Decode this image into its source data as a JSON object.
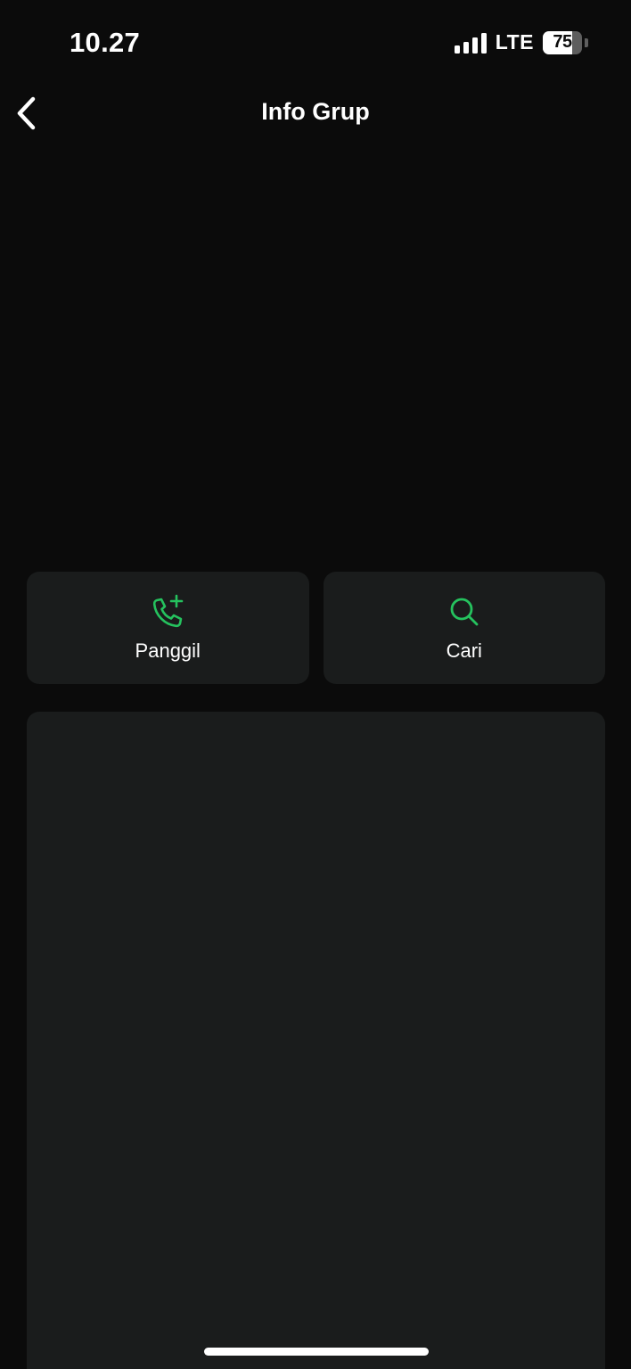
{
  "status_bar": {
    "time": "10.27",
    "network": "LTE",
    "battery": "75",
    "battery_level_percent": 75,
    "signal_bars": 4
  },
  "nav": {
    "title": "Info Grup",
    "back_icon": "chevron-left-icon"
  },
  "actions": [
    {
      "label": "Panggil",
      "icon": "phone-add-icon"
    },
    {
      "label": "Cari",
      "icon": "search-icon"
    }
  ],
  "colors": {
    "background": "#0b0b0b",
    "card": "#1a1c1c",
    "accent": "#25c25e",
    "text": "#ffffff"
  }
}
